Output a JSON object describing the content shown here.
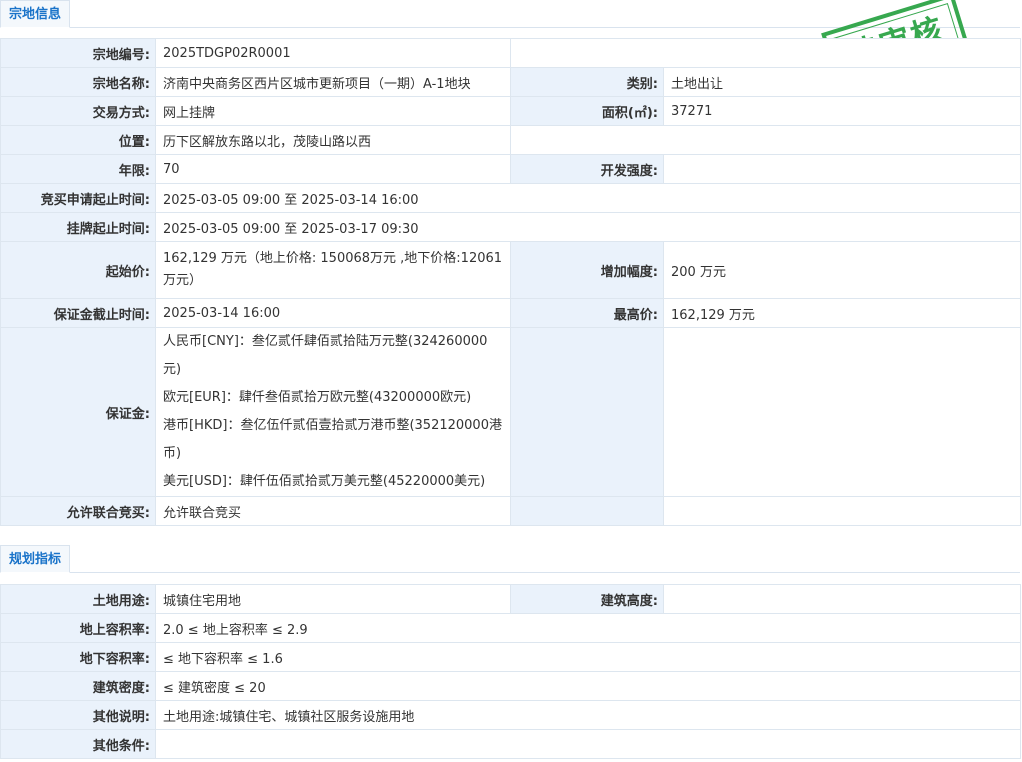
{
  "sections": {
    "parcel_info": "宗地信息",
    "planning": "规划指标"
  },
  "stamp": {
    "text": "待审核",
    "color": "#37a84f"
  },
  "parcel": {
    "code_label": "宗地编号:",
    "code": "2025TDGP02R0001",
    "name_label": "宗地名称:",
    "name": "济南中央商务区西片区城市更新项目（一期）A-1地块",
    "category_label": "类别:",
    "category": "土地出让",
    "method_label": "交易方式:",
    "method": "网上挂牌",
    "area_label": "面积(㎡):",
    "area": "37271",
    "location_label": "位置:",
    "location": "历下区解放东路以北，茂陵山路以西",
    "term_label": "年限:",
    "term": "70",
    "intensity_label": "开发强度:",
    "intensity": "",
    "apply_period_label": "竞买申请起止时间:",
    "apply_period": "2025-03-05 09:00 至 2025-03-14 16:00",
    "listing_period_label": "挂牌起止时间:",
    "listing_period": "2025-03-05 09:00 至 2025-03-17 09:30",
    "start_price_label": "起始价:",
    "start_price": "162,129 万元（地上价格: 150068万元 ,地下价格:12061万元）",
    "increment_label": "增加幅度:",
    "increment": "200 万元",
    "deposit_deadline_label": "保证金截止时间:",
    "deposit_deadline": "2025-03-14 16:00",
    "max_price_label": "最高价:",
    "max_price": "162,129 万元",
    "deposit_label": "保证金:",
    "deposit_cny": "人民币[CNY]：叁亿贰仟肆佰贰拾陆万元整(324260000元)",
    "deposit_eur": "欧元[EUR]：肆仟叁佰贰拾万欧元整(43200000欧元)",
    "deposit_hkd": "港币[HKD]：叁亿伍仟贰佰壹拾贰万港币整(352120000港币)",
    "deposit_usd": "美元[USD]：肆仟伍佰贰拾贰万美元整(45220000美元)",
    "joint_bid_label": "允许联合竞买:",
    "joint_bid": "允许联合竞买"
  },
  "planning": {
    "use_label": "土地用途:",
    "use": "城镇住宅用地",
    "height_label": "建筑高度:",
    "height": "",
    "far_above_label": "地上容积率:",
    "far_above": "2.0 ≤ 地上容积率 ≤ 2.9",
    "far_below_label": "地下容积率:",
    "far_below": "≤ 地下容积率 ≤ 1.6",
    "density_label": "建筑密度:",
    "density": "≤ 建筑密度 ≤ 20",
    "notes_label": "其他说明:",
    "notes": "土地用途:城镇住宅、城镇社区服务设施用地",
    "conditions_label": "其他条件:",
    "conditions": ""
  }
}
